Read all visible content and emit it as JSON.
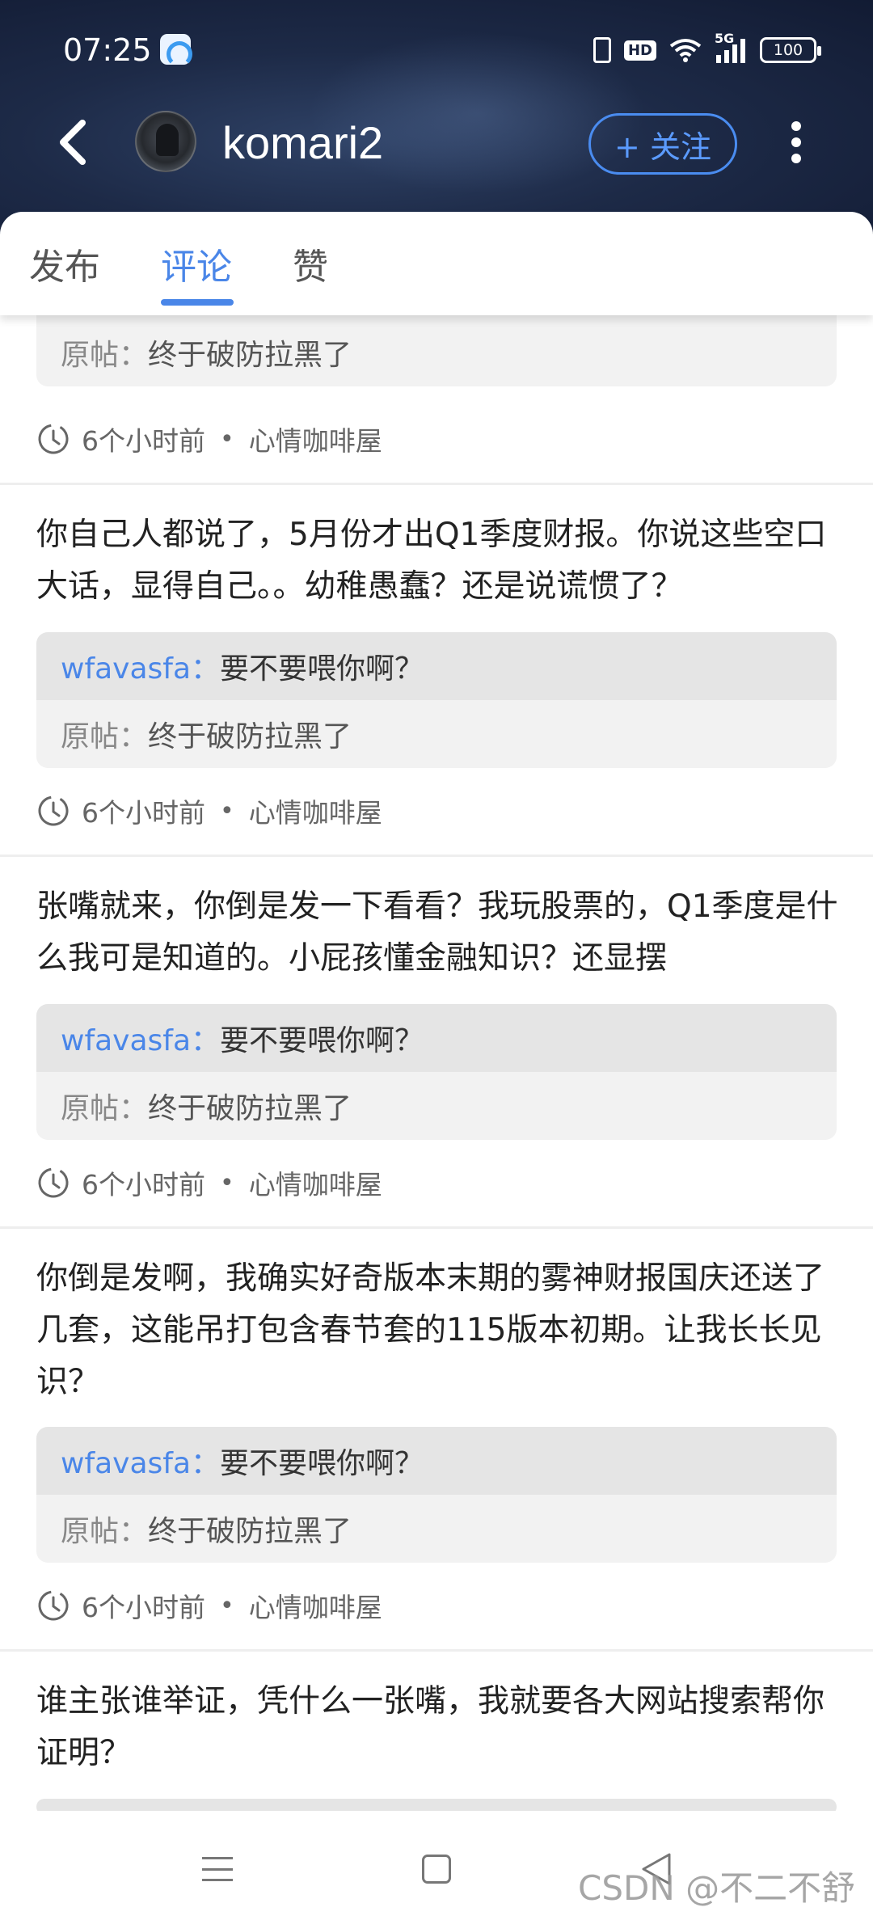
{
  "status_bar": {
    "time": "07:25",
    "hd_label": "HD",
    "network_label": "5G",
    "battery": "100"
  },
  "header": {
    "username": "komari2",
    "follow_label": "+ 关注"
  },
  "tabs": [
    {
      "label": "发布",
      "active": false
    },
    {
      "label": "评论",
      "active": true
    },
    {
      "label": "赞",
      "active": false
    }
  ],
  "partial_item": {
    "orig_label": "原帖：",
    "orig_text": "终于破防拉黑了",
    "time": "6个小时前",
    "separator": "•",
    "forum": "心情咖啡屋"
  },
  "comments": [
    {
      "text": "你自己人都说了，5月份才出Q1季度财报。你说这些空口大话，显得自己。。幼稚愚蠢？还是说谎惯了？",
      "reply_user": "wfavasfa：",
      "reply_text": "要不要喂你啊？",
      "orig_label": "原帖：",
      "orig_text": "终于破防拉黑了",
      "time": "6个小时前",
      "separator": "•",
      "forum": "心情咖啡屋"
    },
    {
      "text": "张嘴就来，你倒是发一下看看？我玩股票的，Q1季度是什么我可是知道的。小屁孩懂金融知识？还显摆",
      "reply_user": "wfavasfa：",
      "reply_text": "要不要喂你啊？",
      "orig_label": "原帖：",
      "orig_text": "终于破防拉黑了",
      "time": "6个小时前",
      "separator": "•",
      "forum": "心情咖啡屋"
    },
    {
      "text": "你倒是发啊，我确实好奇版本末期的雾神财报国庆还送了几套，这能吊打包含春节套的115版本初期。让我长长见识？",
      "reply_user": "wfavasfa：",
      "reply_text": "要不要喂你啊？",
      "orig_label": "原帖：",
      "orig_text": "终于破防拉黑了",
      "time": "6个小时前",
      "separator": "•",
      "forum": "心情咖啡屋"
    },
    {
      "text": "谁主张谁举证，凭什么一张嘴，我就要各大网站搜索帮你证明？"
    }
  ],
  "watermark": "CSDN @不二不舒服",
  "colors": {
    "accent": "#4a86e8",
    "header_bg": "#1d2a47"
  },
  "icons": [
    "back-arrow-icon",
    "more-vertical-icon",
    "clock-icon",
    "menu-icon",
    "home-square-icon",
    "back-triangle-icon",
    "wifi-icon",
    "signal-icon",
    "vibrate-icon"
  ]
}
